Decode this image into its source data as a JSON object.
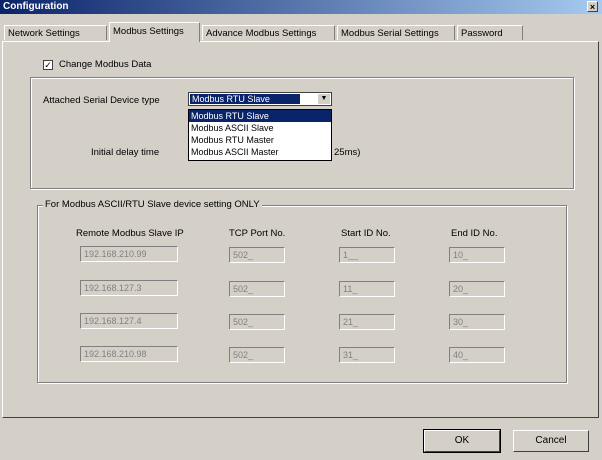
{
  "window": {
    "title": "Configuration",
    "close_glyph": "×"
  },
  "tabs": [
    {
      "label": "Network Settings"
    },
    {
      "label": "Modbus Settings"
    },
    {
      "label": "Advance Modbus Settings"
    },
    {
      "label": "Modbus Serial Settings"
    },
    {
      "label": "Password"
    }
  ],
  "active_tab": "Modbus Settings",
  "change_modbus": {
    "label": "Change Modbus Data",
    "checked": true,
    "check_glyph": "✓"
  },
  "serial": {
    "label": "Attached Serial Device type",
    "selected": "Modbus RTU Slave",
    "options": [
      "Modbus RTU Slave",
      "Modbus ASCII Slave",
      "Modbus RTU Master",
      "Modbus ASCII Master"
    ],
    "initial_delay_label": "Initial delay time",
    "initial_delay_suffix": "25ms)"
  },
  "slave_group": {
    "legend": "For Modbus ASCII/RTU Slave device setting ONLY",
    "headers": [
      "Remote Modbus Slave IP",
      "TCP Port No.",
      "Start ID No.",
      "End ID No."
    ],
    "rows": [
      {
        "ip": "192.168.210.99",
        "port": "502_",
        "start": "1__",
        "end": "10_"
      },
      {
        "ip": "192.168.127.3",
        "port": "502_",
        "start": "11_",
        "end": "20_"
      },
      {
        "ip": "192.168.127.4",
        "port": "502_",
        "start": "21_",
        "end": "30_"
      },
      {
        "ip": "192.168.210.98",
        "port": "502_",
        "start": "31_",
        "end": "40_"
      }
    ]
  },
  "buttons": {
    "ok": "OK",
    "cancel": "Cancel"
  }
}
